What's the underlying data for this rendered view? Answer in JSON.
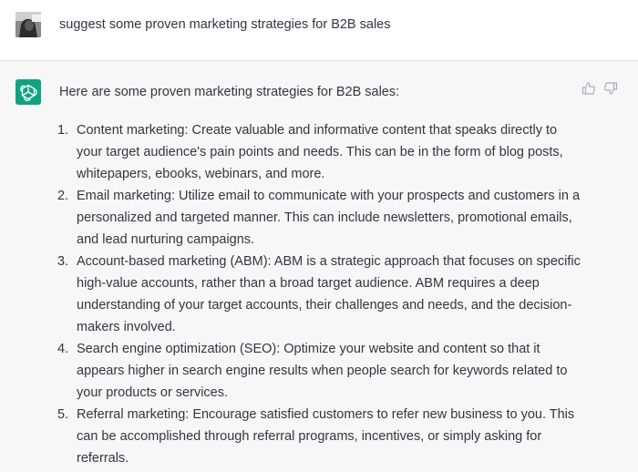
{
  "user_message": {
    "text": "suggest some proven marketing strategies for B2B sales"
  },
  "assistant_message": {
    "intro": "Here are some proven marketing strategies for B2B sales:",
    "items": [
      {
        "number": "1.",
        "lines": [
          "Content marketing: Create valuable and informative content that speaks directly to",
          "your target audience's pain points and needs. This can be in the form of blog posts,",
          "whitepapers, ebooks, webinars, and more."
        ]
      },
      {
        "number": "2.",
        "lines": [
          "Email marketing: Utilize email to communicate with your prospects and customers in a",
          "personalized and targeted manner. This can include newsletters, promotional emails,",
          "and lead nurturing campaigns."
        ]
      },
      {
        "number": "3.",
        "lines": [
          "Account-based marketing (ABM): ABM is a strategic approach that focuses on specific",
          "high-value accounts, rather than a broad target audience. ABM requires a deep",
          "understanding of your target accounts, their challenges and needs, and the decision-",
          "makers involved."
        ]
      },
      {
        "number": "4.",
        "lines": [
          "Search engine optimization (SEO): Optimize your website and content so that it",
          "appears higher in search engine results when people search for keywords related to",
          "your products or services."
        ]
      },
      {
        "number": "5.",
        "lines": [
          "Referral marketing: Encourage satisfied customers to refer new business to you. This",
          "can be accomplished through referral programs, incentives, or simply asking for",
          "referrals."
        ]
      }
    ]
  },
  "icons": {
    "user_avatar": "user-avatar-photo",
    "assistant_avatar": "openai-logo-icon",
    "thumbs_up": "thumbs-up-icon",
    "thumbs_down": "thumbs-down-icon"
  },
  "colors": {
    "assistant_background": "#f7f7f8",
    "assistant_avatar": "#10a37f",
    "text": "#343541",
    "icon": "#acacbe"
  }
}
